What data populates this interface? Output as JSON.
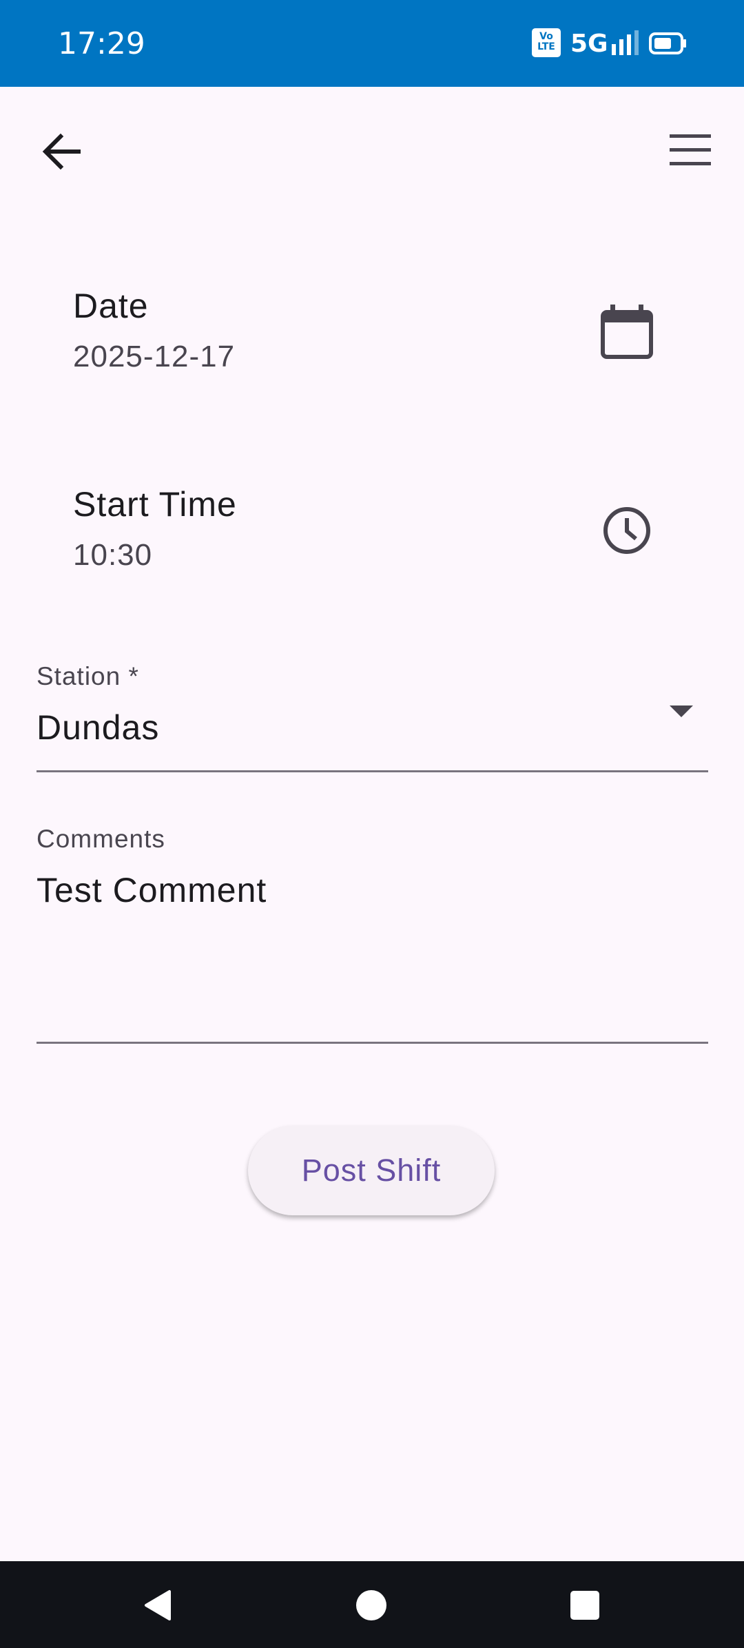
{
  "status_bar": {
    "time": "17:29",
    "volte_line1": "Vo",
    "volte_line2": "LTE",
    "network": "5G",
    "signal_icon": "signal-bars-icon",
    "battery_icon": "battery-icon"
  },
  "app_bar": {
    "back_icon": "arrow-back-icon",
    "menu_icon": "hamburger-menu-icon"
  },
  "date_row": {
    "label": "Date",
    "value": "2025-12-17",
    "icon": "calendar-icon"
  },
  "time_row": {
    "label": "Start Time",
    "value": "10:30",
    "icon": "clock-icon"
  },
  "station_field": {
    "label": "Station *",
    "value": "Dundas",
    "icon": "dropdown-arrow-icon"
  },
  "comments_field": {
    "label": "Comments",
    "value": "Test Comment"
  },
  "post_button": {
    "label": "Post Shift"
  },
  "colors": {
    "status_bar": "#0075C2",
    "background": "#FDF7FD",
    "primary": "#6750A4",
    "nav_bar": "#111318"
  }
}
